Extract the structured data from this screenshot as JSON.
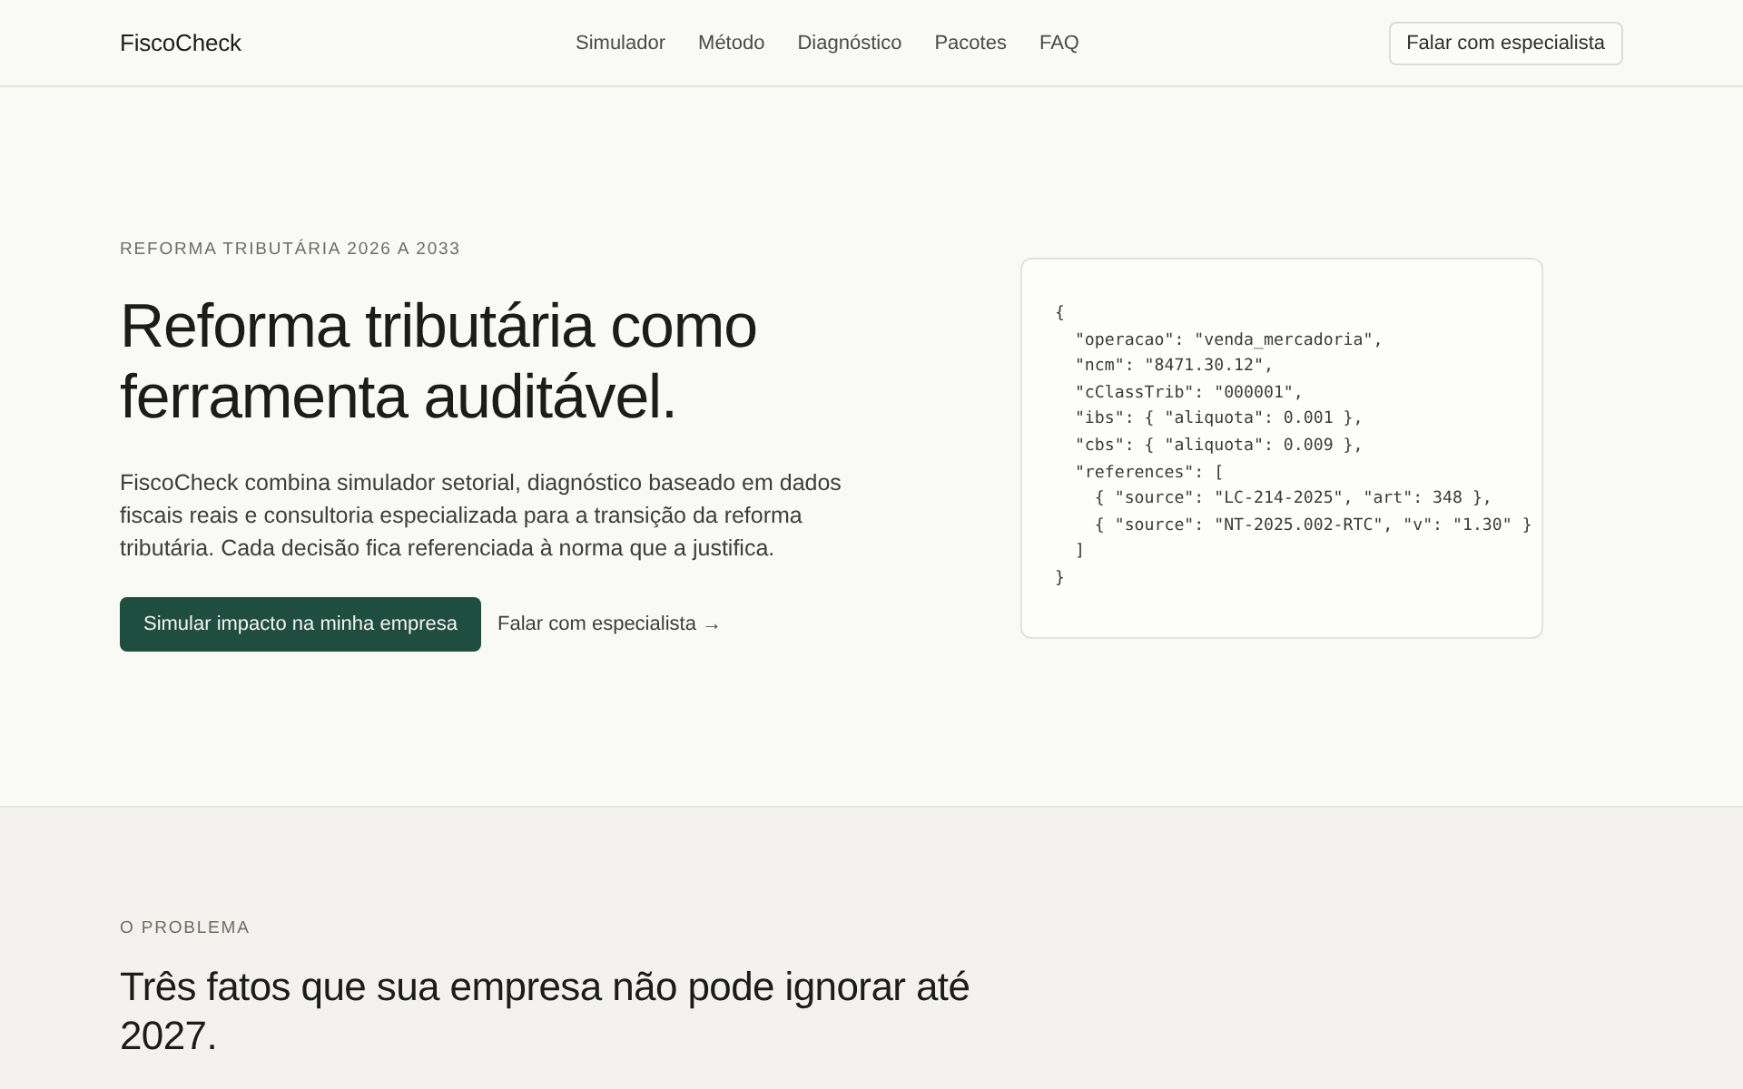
{
  "header": {
    "logo": "FiscoCheck",
    "nav": [
      "Simulador",
      "Método",
      "Diagnóstico",
      "Pacotes",
      "FAQ"
    ],
    "cta": "Falar com especialista"
  },
  "hero": {
    "eyebrow": "REFORMA TRIBUTÁRIA 2026 A 2033",
    "title": "Reforma tributária como ferramenta auditável.",
    "lead": "FiscoCheck combina simulador setorial, diagnóstico baseado em dados fiscais reais e consultoria especializada para a transição da reforma tributária. Cada decisão fica referenciada à norma que a justifica.",
    "primary_button": "Simular impacto na minha empresa",
    "secondary_link": "Falar com especialista →",
    "code": "{\n  \"operacao\": \"venda_mercadoria\",\n  \"ncm\": \"8471.30.12\",\n  \"cClassTrib\": \"000001\",\n  \"ibs\": { \"aliquota\": 0.001 },\n  \"cbs\": { \"aliquota\": 0.009 },\n  \"references\": [\n    { \"source\": \"LC-214-2025\", \"art\": 348 },\n    { \"source\": \"NT-2025.002-RTC\", \"v\": \"1.30\" }\n  ]\n}"
  },
  "problem": {
    "eyebrow": "O PROBLEMA",
    "title": "Três fatos que sua empresa não pode ignorar até 2027."
  }
}
